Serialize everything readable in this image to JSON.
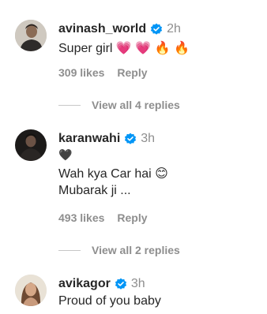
{
  "comments": [
    {
      "username": "avinash_world",
      "time": "2h",
      "text_lines": [
        "Super girl 💗 💗 🔥 🔥"
      ],
      "likes": "309 likes",
      "reply_label": "Reply",
      "view_replies": "View all 4 replies"
    },
    {
      "username": "karanwahi",
      "time": "3h",
      "text_lines": [
        "🖤",
        "Wah kya Car hai 😊",
        "Mubarak ji ..."
      ],
      "likes": "493 likes",
      "reply_label": "Reply",
      "view_replies": "View all 2 replies"
    },
    {
      "username": "avikagor",
      "time": "3h",
      "text_lines": [
        "Proud of you baby"
      ]
    }
  ],
  "icons": {
    "verified": "verified-badge-icon",
    "verified_color": "#0095f6"
  }
}
